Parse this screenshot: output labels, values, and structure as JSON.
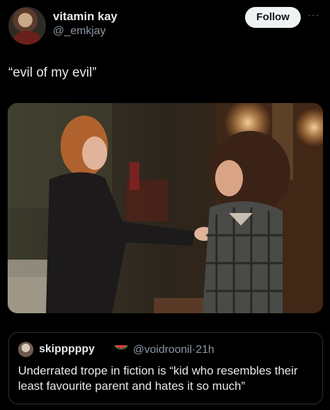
{
  "post": {
    "display_name": "vitamin kay",
    "handle": "@_emkjay",
    "follow_label": "Follow",
    "more_label": "···",
    "text": "“evil of my evil”"
  },
  "quote": {
    "display_name": "skipppppy",
    "emoji": "watermelon-icon",
    "handle": "@voidroonil",
    "separator": "·",
    "time": "21h",
    "text": "Underrated trope in fiction is “kid who resembles their least favourite parent and hates it so much”"
  },
  "colors": {
    "background": "#000000",
    "text_primary": "#e7e9ea",
    "text_secondary": "#8b98a5",
    "follow_bg": "#eff3f4",
    "border": "#2f3336"
  }
}
